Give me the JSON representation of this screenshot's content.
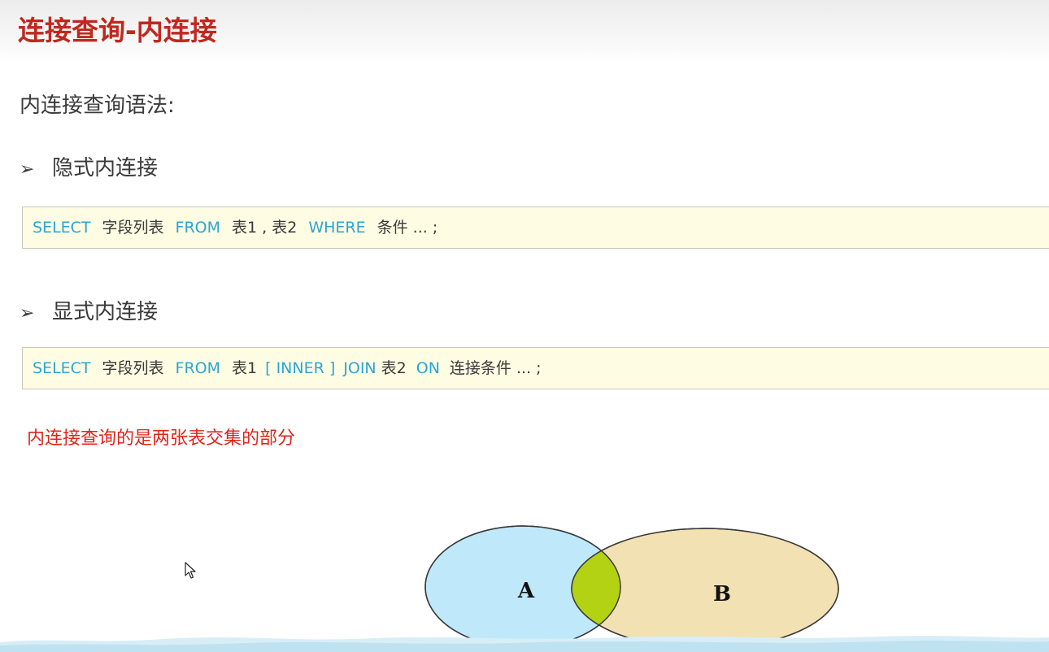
{
  "title": "连接查询-内连接",
  "syntax_heading": "内连接查询语法:",
  "bullet_arrow": "➢",
  "implicit": {
    "label": "隐式内连接",
    "code": [
      {
        "text": "SELECT",
        "kind": "kw"
      },
      {
        "text": "字段列表",
        "kind": "tx"
      },
      {
        "text": "FROM",
        "kind": "kw"
      },
      {
        "text": "表1 , 表2",
        "kind": "tx"
      },
      {
        "text": "WHERE",
        "kind": "kw"
      },
      {
        "text": "条件 ... ;",
        "kind": "tx"
      }
    ]
  },
  "explicit": {
    "label": "显式内连接",
    "code": [
      {
        "text": "SELECT",
        "kind": "kw"
      },
      {
        "text": "字段列表",
        "kind": "tx"
      },
      {
        "text": "FROM",
        "kind": "kw"
      },
      {
        "text": "表1",
        "kind": "tx"
      },
      {
        "text": "[ INNER ]",
        "kind": "kw"
      },
      {
        "text": "JOIN",
        "kind": "kw"
      },
      {
        "text": "表2",
        "kind": "tx"
      },
      {
        "text": "ON",
        "kind": "kw"
      },
      {
        "text": "连接条件 ... ;",
        "kind": "tx"
      }
    ]
  },
  "note": "内连接查询的是两张表交集的部分",
  "venn": {
    "left_label": "A",
    "right_label": "B",
    "colors": {
      "left": "#bfe9fa",
      "right": "#f2e1b3",
      "intersection": "#b4d214",
      "stroke": "#3a3a3a",
      "keyword": "#2aa6d6",
      "title": "#c0281e",
      "note": "#e0241a",
      "code_bg": "#fefce3"
    }
  },
  "cursor_icon": "arrow-cursor-icon"
}
